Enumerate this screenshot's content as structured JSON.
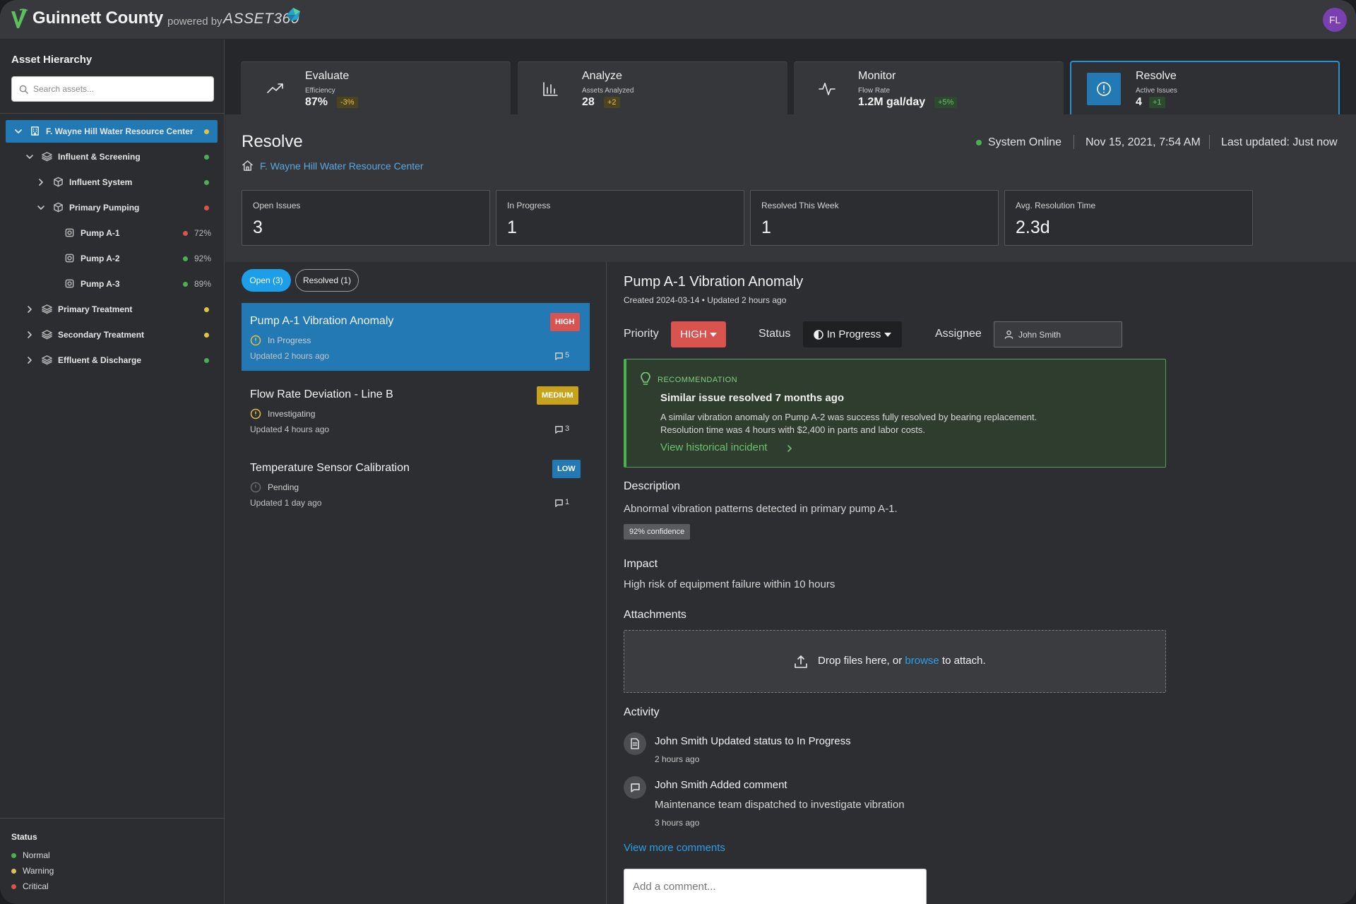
{
  "header": {
    "brand": "Guinnett County",
    "powered_by": "powered by",
    "product": "ASSET360",
    "user_initials": "FL"
  },
  "sidebar": {
    "title": "Asset Hierarchy",
    "search_placeholder": "Search assets...",
    "tree": [
      {
        "label": "F. Wayne Hill Water Resource Center",
        "status": "warning",
        "selected": true,
        "expanded": true
      },
      {
        "label": "Influent & Screening",
        "status": "normal",
        "expanded": true
      },
      {
        "label": "Influent System",
        "status": "normal",
        "expanded": false
      },
      {
        "label": "Primary Pumping",
        "status": "critical",
        "expanded": true
      },
      {
        "label": "Pump A-1",
        "status": "critical",
        "health": "72%"
      },
      {
        "label": "Pump A-2",
        "status": "normal",
        "health": "92%"
      },
      {
        "label": "Pump A-3",
        "status": "normal",
        "health": "89%"
      },
      {
        "label": "Primary Treatment",
        "status": "warning",
        "expanded": false
      },
      {
        "label": "Secondary Treatment",
        "status": "warning",
        "expanded": false
      },
      {
        "label": "Effluent & Discharge",
        "status": "normal",
        "expanded": false
      }
    ],
    "legend": {
      "title": "Status",
      "items": [
        {
          "label": "Normal",
          "color": "#4caf50"
        },
        {
          "label": "Warning",
          "color": "#e0c24a"
        },
        {
          "label": "Critical",
          "color": "#d9534f"
        }
      ]
    }
  },
  "nav": [
    {
      "title": "Evaluate",
      "metric_label": "Efficiency",
      "value": "87%",
      "delta": "-3%",
      "icon": "trending-up-icon"
    },
    {
      "title": "Analyze",
      "metric_label": "Assets Analyzed",
      "value": "28",
      "delta": "+2",
      "icon": "bar-chart-icon"
    },
    {
      "title": "Monitor",
      "metric_label": "Flow Rate",
      "value": "1.2M gal/day",
      "delta": "+5%",
      "icon": "pulse-icon"
    },
    {
      "title": "Resolve",
      "metric_label": "Active Issues",
      "value": "4",
      "delta": "+1",
      "icon": "alert-circle-icon",
      "active": true
    }
  ],
  "page": {
    "title": "Resolve",
    "breadcrumb": "F. Wayne Hill Water Resource Center",
    "system_status": "System Online",
    "datetime": "Nov 15, 2021, 7:54 AM",
    "last_updated": "Last updated: Just now"
  },
  "stats": [
    {
      "label": "Open Issues",
      "value": "3"
    },
    {
      "label": "In Progress",
      "value": "1"
    },
    {
      "label": "Resolved This Week",
      "value": "1"
    },
    {
      "label": "Avg. Resolution Time",
      "value": "2.3d"
    }
  ],
  "filters": {
    "open": "Open (3)",
    "resolved": "Resolved (1)"
  },
  "issues": [
    {
      "title": "Pump A-1 Vibration Anomaly",
      "status": "In Progress",
      "updated": "Updated 2 hours ago",
      "comments": "5",
      "priority": "HIGH"
    },
    {
      "title": "Flow Rate Deviation - Line B",
      "status": "Investigating",
      "updated": "Updated 4 hours ago",
      "comments": "3",
      "priority": "MEDIUM"
    },
    {
      "title": "Temperature Sensor Calibration",
      "status": "Pending",
      "updated": "Updated 1 day ago",
      "comments": "1",
      "priority": "LOW"
    }
  ],
  "detail": {
    "title": "Pump A-1 Vibration Anomaly",
    "meta": "Created 2024-03-14 • Updated 2 hours ago",
    "priority_label": "Priority",
    "priority_value": "HIGH",
    "status_label": "Status",
    "status_value": "In Progress",
    "assignee_label": "Assignee",
    "assignee_value": "John Smith",
    "recommendation": {
      "kicker": "RECOMMENDATION",
      "heading": "Similar issue resolved 7 months ago",
      "line1": "A similar vibration anomaly on Pump A-2 was success fully resolved by bearing replacement.",
      "line2": "Resolution time was 4 hours with $2,400 in parts and labor costs.",
      "link": "View historical incident"
    },
    "description_heading": "Description",
    "description": "Abnormal vibration patterns detected in primary pump A-1.",
    "confidence": "92% confidence",
    "impact_heading": "Impact",
    "impact": "High risk of equipment failure within 10 hours",
    "attachments_heading": "Attachments",
    "drop_prefix": "Drop files here, or",
    "drop_link": "browse",
    "drop_suffix": "to attach.",
    "activity_heading": "Activity",
    "activity": [
      {
        "title": "John Smith Updated status to In Progress",
        "time": "2 hours ago",
        "body": ""
      },
      {
        "title": "John Smith Added comment",
        "body": "Maintenance team dispatched to investigate vibration",
        "time": "3 hours ago"
      }
    ],
    "view_more": "View more comments",
    "comment_placeholder": "Add a comment..."
  },
  "colors": {
    "accent": "#2379b4",
    "link": "#2b9fe8",
    "high": "#d9534f",
    "medium": "#c9a21b",
    "low": "#2379b4",
    "normal": "#4caf50",
    "warning": "#e0c24a",
    "critical": "#d9534f"
  }
}
